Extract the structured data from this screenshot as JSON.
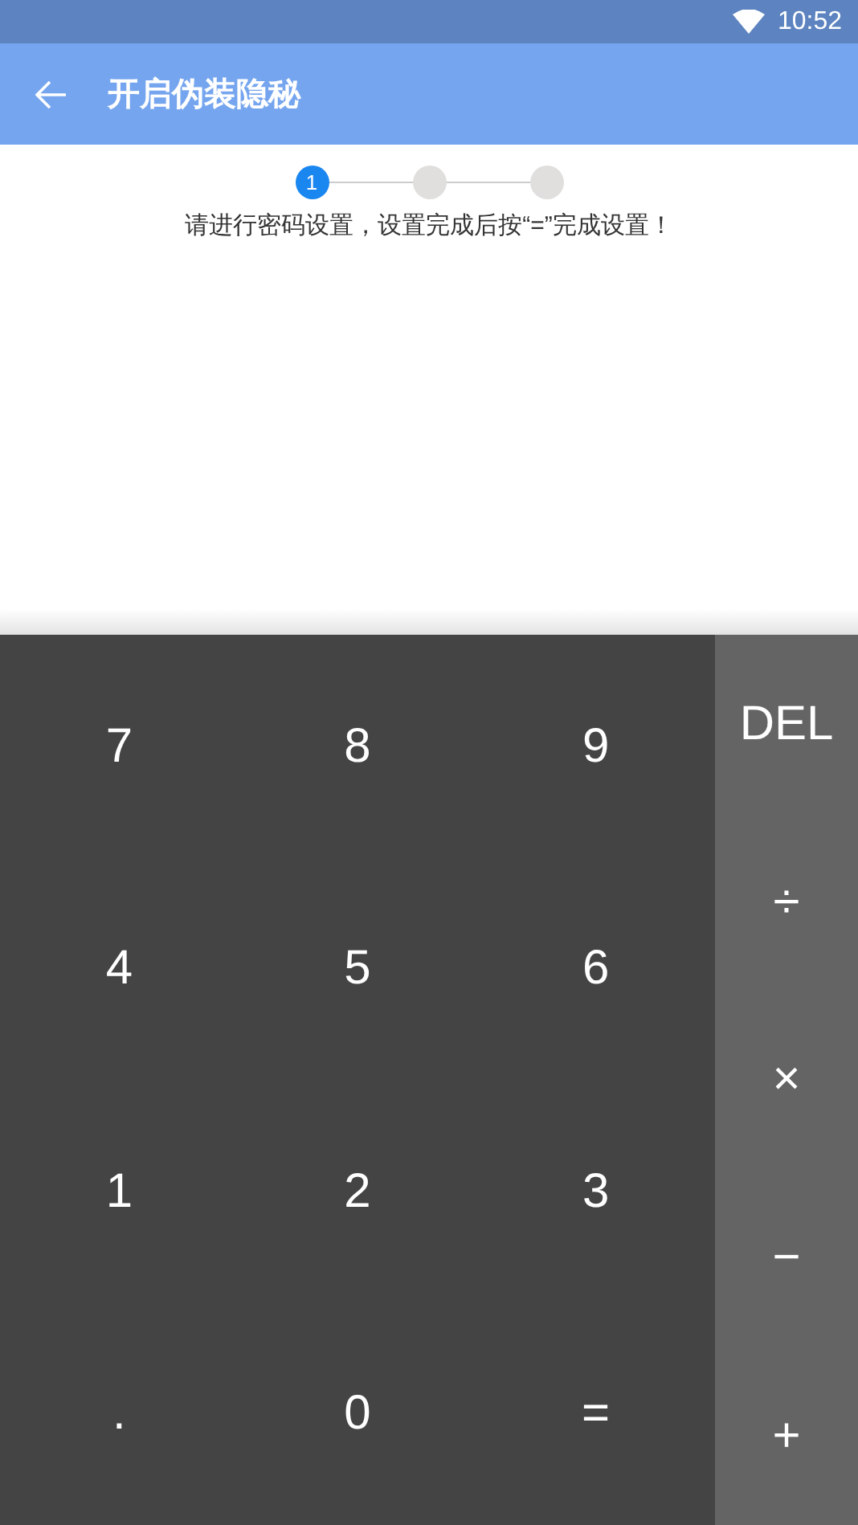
{
  "status_bar": {
    "time": "10:52"
  },
  "app_bar": {
    "title": "开启伪装隐秘"
  },
  "steps": [
    {
      "label": "1",
      "selected": true
    },
    {
      "selected": false
    },
    {
      "selected": false
    }
  ],
  "instruction": "请进行密码设置，设置完成后按“=”完成设置！",
  "keypad": {
    "digits": [
      "7",
      "8",
      "9",
      "4",
      "5",
      "6",
      "1",
      "2",
      "3",
      ".",
      "0",
      "="
    ],
    "operators": [
      "DEL",
      "÷",
      "×",
      "−",
      "+"
    ]
  }
}
